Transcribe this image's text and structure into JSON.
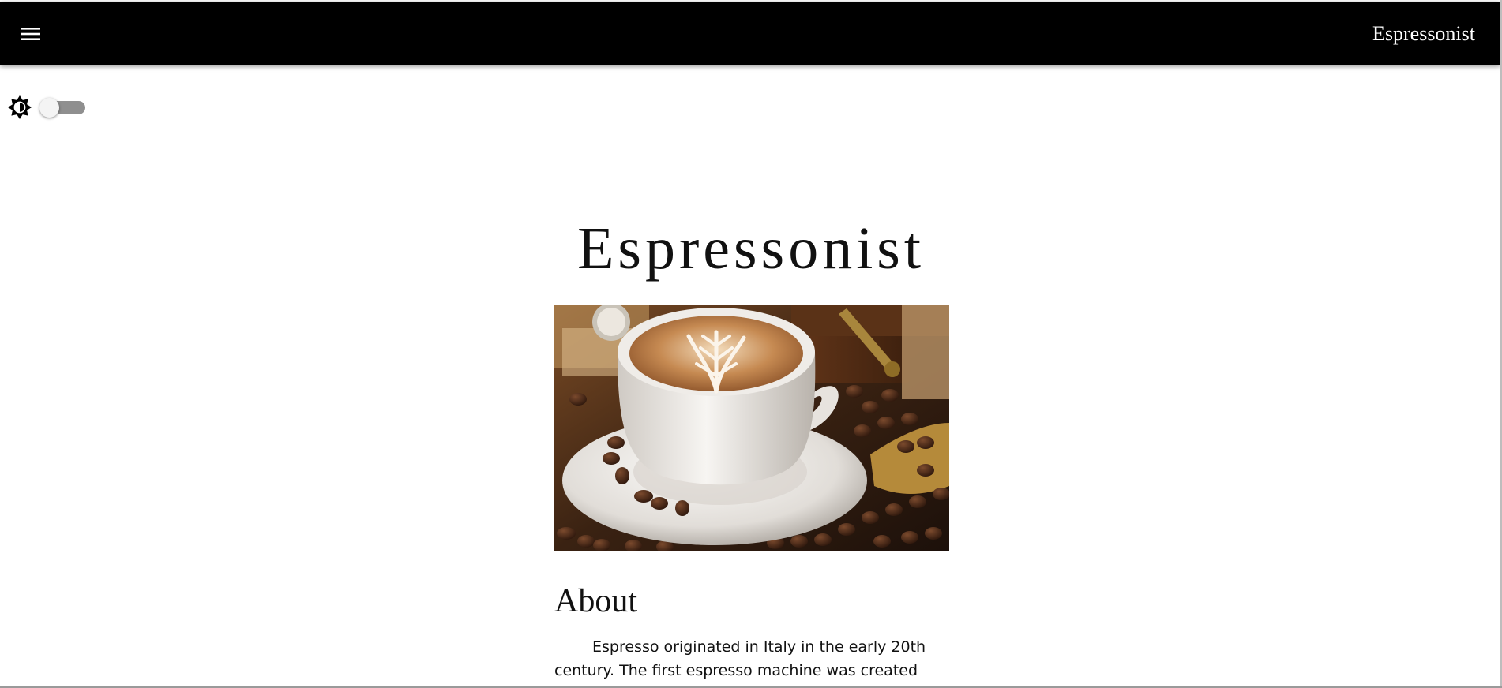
{
  "header": {
    "menu_icon": "hamburger-menu-icon",
    "brand": "Espressonist"
  },
  "theme_toggle": {
    "icon": "brightness-icon",
    "state": "off"
  },
  "hero": {
    "title": "Espressonist",
    "image": "latte-art-cup-with-coffee-beans"
  },
  "about": {
    "heading": "About",
    "text": "Espresso originated in Italy in the early 20th century. The first espresso machine was created in"
  },
  "colors": {
    "header_bg": "#000000",
    "header_text": "#ffffff",
    "page_bg": "#ffffff",
    "toggle_track": "#8f8f8f"
  }
}
